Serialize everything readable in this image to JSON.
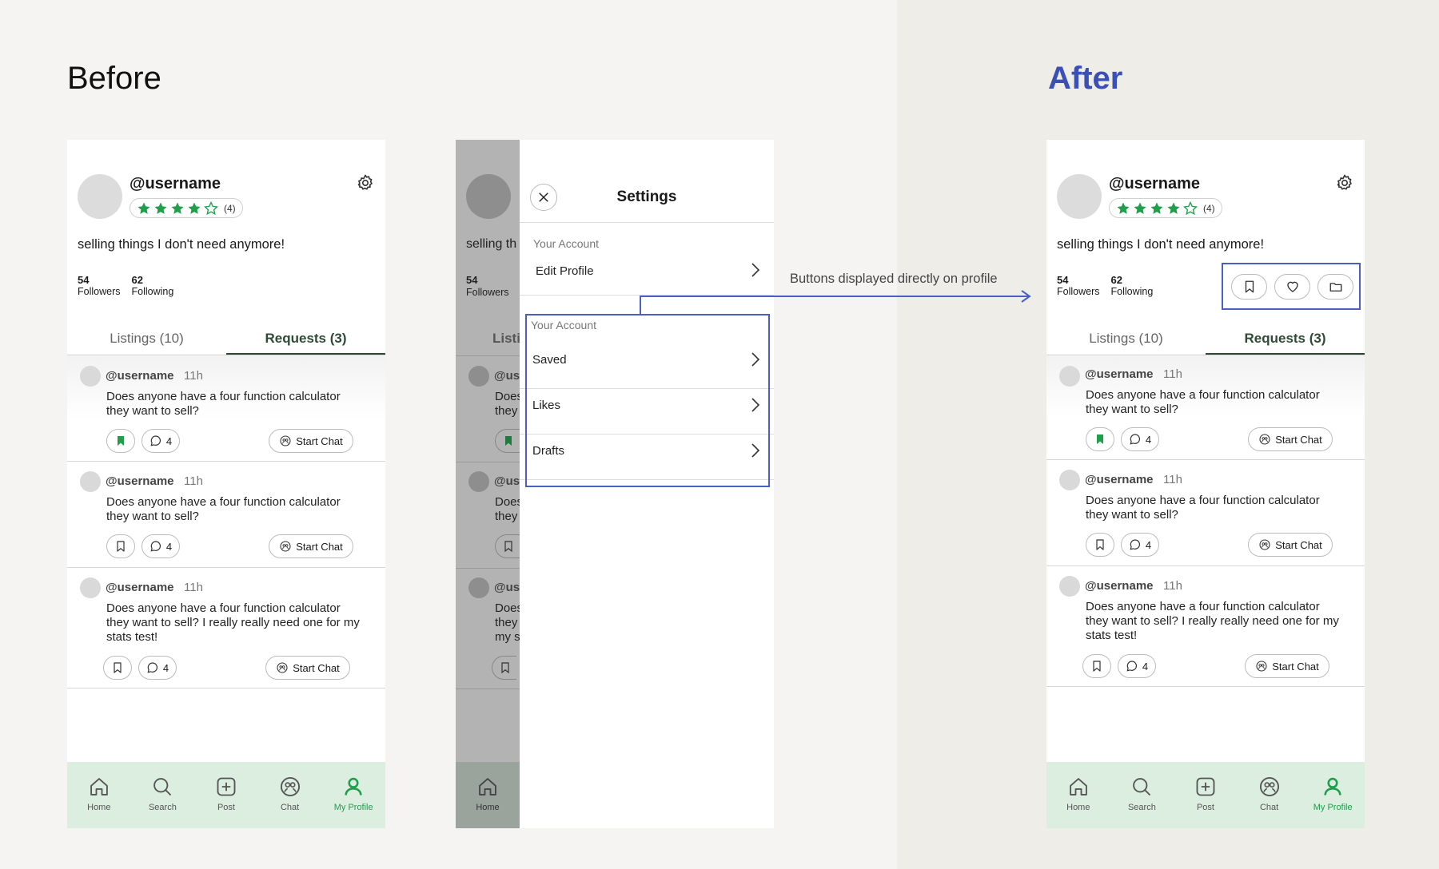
{
  "headings": {
    "before": "Before",
    "after": "After"
  },
  "annotation": "Buttons displayed directly on profile",
  "colors": {
    "accent_blue": "#3b4fb8",
    "brand_green": "#1f9e4c",
    "nav_bg": "#dbeee0",
    "star_green": "#1f9e4c"
  },
  "profile": {
    "username": "@username",
    "rating_stars": 4,
    "rating_count": "(4)",
    "bio": "selling things I don't need anymore!",
    "followers_count": "54",
    "followers_label": "Followers",
    "following_count": "62",
    "following_label": "Following",
    "settings_icon": "gear-icon"
  },
  "tabs": [
    {
      "label": "Listings (10)",
      "active": false
    },
    {
      "label": "Requests (3)",
      "active": true
    }
  ],
  "posts": [
    {
      "user": "@username",
      "time": "11h",
      "text": "Does anyone have a four function calculator they want to sell?",
      "bookmarked": true,
      "comments": "4",
      "chat_label": "Start Chat"
    },
    {
      "user": "@username",
      "time": "11h",
      "text": "Does anyone have a four function calculator they want to sell?",
      "bookmarked": false,
      "comments": "4",
      "chat_label": "Start Chat"
    },
    {
      "user": "@username",
      "time": "11h",
      "text": "Does anyone have a four function calculator they want to sell? I really really need one for my stats test!",
      "bookmarked": false,
      "comments": "4",
      "chat_label": "Start Chat"
    }
  ],
  "nav": [
    {
      "label": "Home",
      "icon": "home-icon",
      "active": false
    },
    {
      "label": "Search",
      "icon": "search-icon",
      "active": false
    },
    {
      "label": "Post",
      "icon": "plus-square-icon",
      "active": false
    },
    {
      "label": "Chat",
      "icon": "chat-icon",
      "active": false
    },
    {
      "label": "My Profile",
      "icon": "person-icon",
      "active": true
    }
  ],
  "settings": {
    "title": "Settings",
    "section1_label": "Your Account",
    "edit_profile": "Edit Profile",
    "section2_label": "Your Account",
    "items": [
      "Saved",
      "Likes",
      "Drafts"
    ]
  },
  "background_fragments": {
    "bio": "selling th",
    "followers_count": "54",
    "followers_label": "Followers",
    "tab": "Listi",
    "user": "@us",
    "line1": "Does",
    "line2": "they",
    "line3": "my s",
    "home": "Home"
  }
}
